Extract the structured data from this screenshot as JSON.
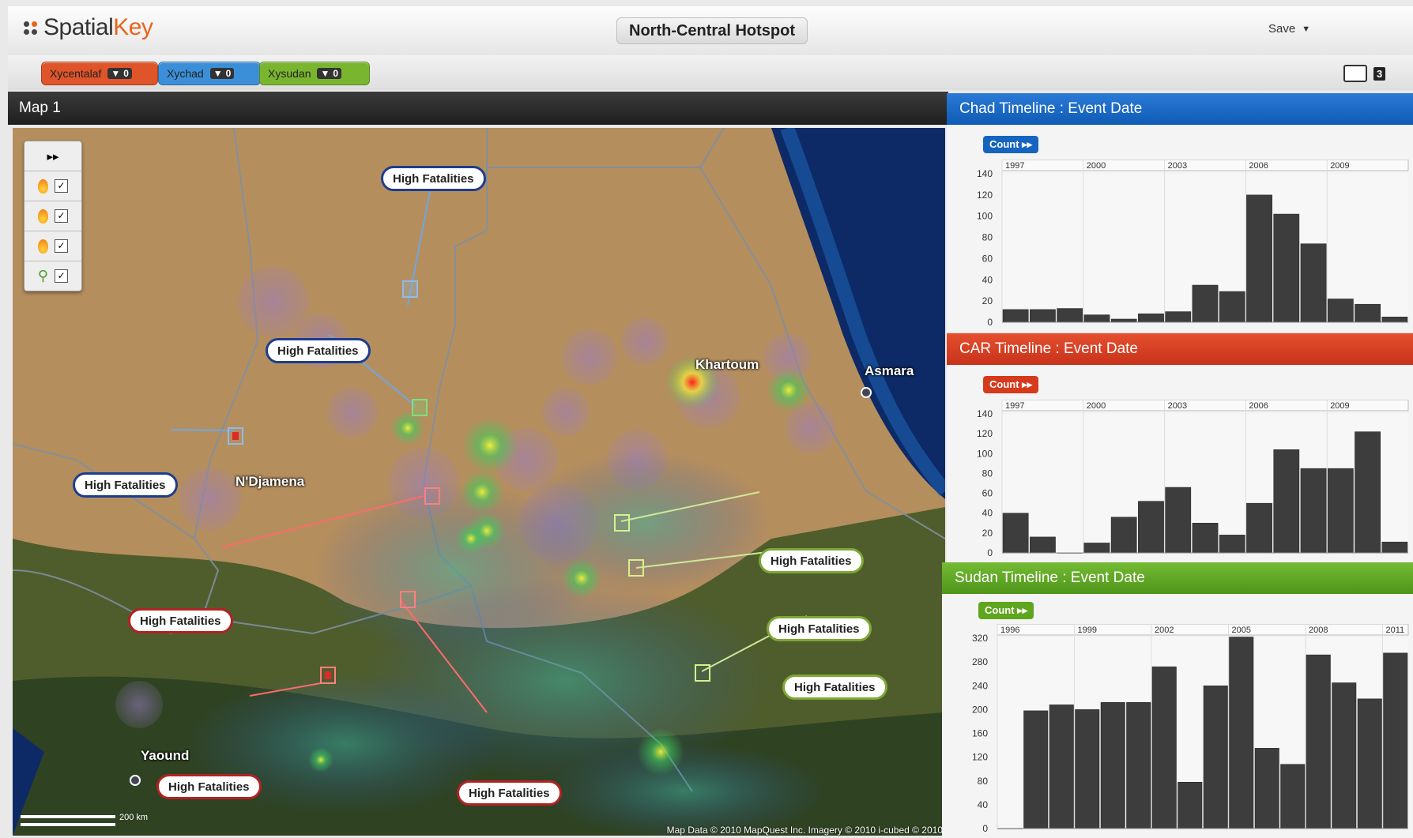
{
  "header": {
    "logo_left": "Spatial",
    "logo_right": "Key",
    "title": "North-Central Hotspot",
    "save_label": "Save"
  },
  "filters": [
    {
      "label": "Xycentalaf",
      "count": "0",
      "color": "#e0542a"
    },
    {
      "label": "Xychad",
      "count": "0",
      "color": "#3b8fd8"
    },
    {
      "label": "Xysudan",
      "count": "0",
      "color": "#7ab52f"
    }
  ],
  "window_count": "3",
  "map": {
    "tab_title": "Map 1",
    "labels": {
      "khartoum": "Khartoum",
      "asmara": "Asmara",
      "ndjamena": "N'Djamena",
      "yaounde": "Yaound"
    },
    "callout_text": "High Fatalities",
    "scale_text": "200 km",
    "credits": "Map Data © 2010 MapQuest Inc. Imagery © 2010 i-cubed  © 2010"
  },
  "timelines": [
    {
      "title": "Chad Timeline : Event Date",
      "count_label": "Count ▸▸",
      "color": "#1565c0",
      "chart_data": {
        "type": "bar",
        "title": "Chad Timeline : Event Date",
        "xlabel": "",
        "ylabel": "",
        "tick_labels_x": [
          "1997",
          "2000",
          "2003",
          "2006",
          "2009"
        ],
        "x": [
          1997,
          1998,
          1999,
          2000,
          2001,
          2002,
          2003,
          2004,
          2005,
          2006,
          2007,
          2008,
          2009,
          2010,
          2011
        ],
        "values": [
          12,
          12,
          13,
          7,
          3,
          8,
          10,
          35,
          29,
          120,
          102,
          74,
          22,
          17,
          5
        ],
        "ylim": [
          0,
          140
        ],
        "yticks": [
          0,
          20,
          40,
          60,
          80,
          100,
          120,
          140
        ]
      }
    },
    {
      "title": "CAR Timeline : Event Date",
      "count_label": "Count ▸▸",
      "color": "#d63a1c",
      "chart_data": {
        "type": "bar",
        "title": "CAR Timeline : Event Date",
        "xlabel": "",
        "ylabel": "",
        "tick_labels_x": [
          "1997",
          "2000",
          "2003",
          "2006",
          "2009"
        ],
        "x": [
          1997,
          1998,
          1999,
          2000,
          2001,
          2002,
          2003,
          2004,
          2005,
          2006,
          2007,
          2008,
          2009,
          2010,
          2011
        ],
        "values": [
          40,
          16,
          0,
          10,
          36,
          52,
          66,
          30,
          18,
          50,
          104,
          85,
          85,
          122,
          11
        ],
        "ylim": [
          0,
          140
        ],
        "yticks": [
          0,
          20,
          40,
          60,
          80,
          100,
          120,
          140
        ]
      }
    },
    {
      "title": "Sudan Timeline : Event Date",
      "count_label": "Count ▸▸",
      "color": "#5fa51e",
      "chart_data": {
        "type": "bar",
        "title": "Sudan Timeline : Event Date",
        "xlabel": "",
        "ylabel": "",
        "tick_labels_x": [
          "1996",
          "1999",
          "2002",
          "2005",
          "2008",
          "2011"
        ],
        "x": [
          1996,
          1997,
          1998,
          1999,
          2000,
          2001,
          2002,
          2003,
          2004,
          2005,
          2006,
          2007,
          2008,
          2009,
          2010,
          2011
        ],
        "values": [
          0,
          198,
          208,
          200,
          212,
          212,
          272,
          78,
          240,
          322,
          135,
          108,
          292,
          245,
          218,
          295
        ],
        "ylim": [
          0,
          320
        ],
        "yticks": [
          0,
          40,
          80,
          120,
          160,
          200,
          240,
          280,
          320
        ]
      }
    }
  ]
}
